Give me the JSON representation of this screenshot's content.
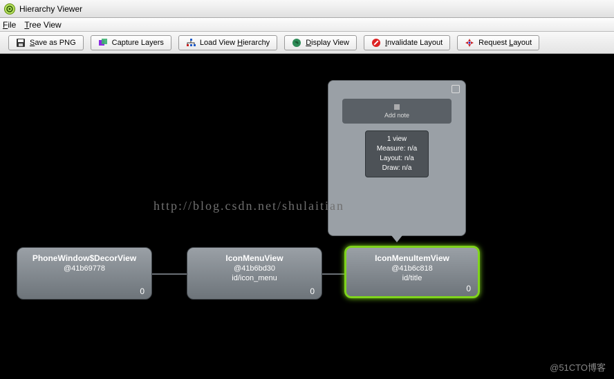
{
  "title": "Hierarchy Viewer",
  "menu": {
    "file": "File",
    "tree": "Tree View"
  },
  "toolbar": {
    "save": "Save as PNG",
    "capture": "Capture Layers",
    "load": "Load View Hierarchy",
    "display": "Display View",
    "invalidate": "Invalidate Layout",
    "request": "Request Layout"
  },
  "nodes": {
    "n1": {
      "name": "PhoneWindow$DecorView",
      "addr": "@41b69778",
      "id": "",
      "count": "0"
    },
    "n2": {
      "name": "IconMenuView",
      "addr": "@41b6bd30",
      "id": "id/icon_menu",
      "count": "0"
    },
    "n3": {
      "name": "IconMenuItemView",
      "addr": "@41b6c818",
      "id": "id/title",
      "count": "0"
    }
  },
  "popup": {
    "preview": "Add note",
    "views": "1 view",
    "measure": "Measure: n/a",
    "layout": "Layout: n/a",
    "draw": "Draw: n/a"
  },
  "watermark": "http://blog.csdn.net/shulaitian",
  "corner": "@51CTO博客"
}
